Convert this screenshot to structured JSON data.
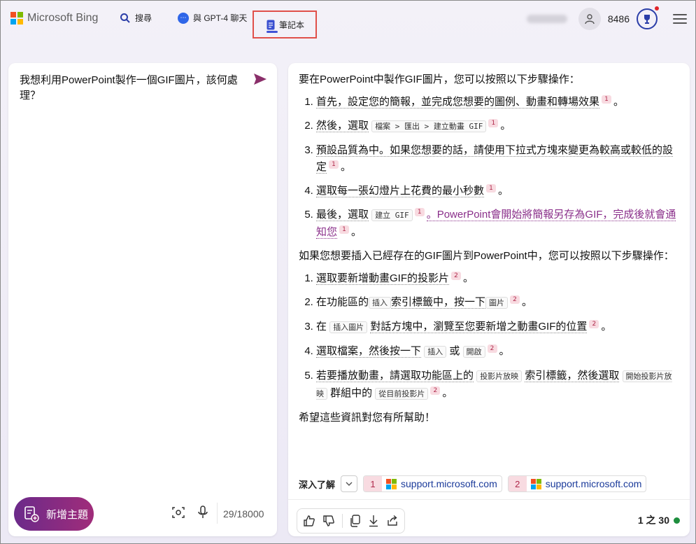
{
  "header": {
    "logo_text": "Microsoft Bing",
    "nav": {
      "search": "搜尋",
      "chat": "與 GPT-4 聊天",
      "notebook": "筆記本"
    },
    "points": "8486",
    "colors": {
      "accent": "#4052d6",
      "highlight_border": "#e0504a"
    }
  },
  "left": {
    "question": "我想利用PowerPoint製作一個GIF圖片，該何處理？",
    "new_topic": "新增主題",
    "counter": "29/18000"
  },
  "answer": {
    "intro": "要在PowerPoint中製作GIF圖片，您可以按照以下步驟操作：",
    "list1": [
      {
        "text": "首先，設定您的簡報，並完成您想要的圖例、動畫和轉場效果",
        "cite": "1"
      },
      {
        "text_a": "然後，選取",
        "code": "檔案 > 匯出 > 建立動畫 GIF",
        "cite": "1"
      },
      {
        "text": "預設品質為中。如果您想要的話，請使用下拉式方塊來變更為較高或較低的設定",
        "cite": "1"
      },
      {
        "text": "選取每一張幻燈片上花費的最小秒數",
        "cite": "1"
      },
      {
        "text_a": "最後，選取",
        "code": "建立 GIF",
        "cite": "1",
        "text_b": "。PowerPoint會開始將簡報另存為GIF，完成後就會通知您",
        "cite_b": "1"
      }
    ],
    "intro2": "如果您想要插入已經存在的GIF圖片到PowerPoint中，您可以按照以下步驟操作：",
    "list2": [
      {
        "text": "選取要新增動畫GIF的投影片",
        "cite": "2"
      },
      {
        "text_a": "在功能區的",
        "code": "插入",
        "text_b": "索引標籤中，按一下",
        "code_b": "圖片",
        "cite": "2"
      },
      {
        "text_a": "在",
        "code": "插入圖片",
        "text_b": "對話方塊中，瀏覽至您要新增之動畫GIF的位置",
        "cite": "2"
      },
      {
        "text_a": "選取檔案，然後按一下",
        "code": "插入",
        "text_b": "或",
        "code_b": "開啟",
        "cite": "2"
      },
      {
        "text_a": "若要播放動畫，請選取功能區上的",
        "code": "投影片放映",
        "text_b": "索引標籤，然後選取",
        "code_b": "開始投影片放映",
        "text_c": "群組中的",
        "code_c": "從目前投影片",
        "cite": "2"
      }
    ],
    "closing": "希望這些資訊對您有所幫助！",
    "period": "。"
  },
  "learn_more": {
    "label": "深入了解",
    "sources": [
      {
        "num": "1",
        "domain": "support.microsoft.com"
      },
      {
        "num": "2",
        "domain": "support.microsoft.com"
      }
    ]
  },
  "footer": {
    "page_count": "1 之 30"
  },
  "icons": [
    "search-icon",
    "chat-icon",
    "notebook-icon",
    "avatar-icon",
    "trophy-icon",
    "menu-icon",
    "send-icon",
    "new-topic-icon",
    "scan-icon",
    "microphone-icon",
    "chevron-down-icon",
    "thumbs-up-icon",
    "thumbs-down-icon",
    "copy-icon",
    "download-icon",
    "share-icon",
    "windows-logo-icon"
  ]
}
